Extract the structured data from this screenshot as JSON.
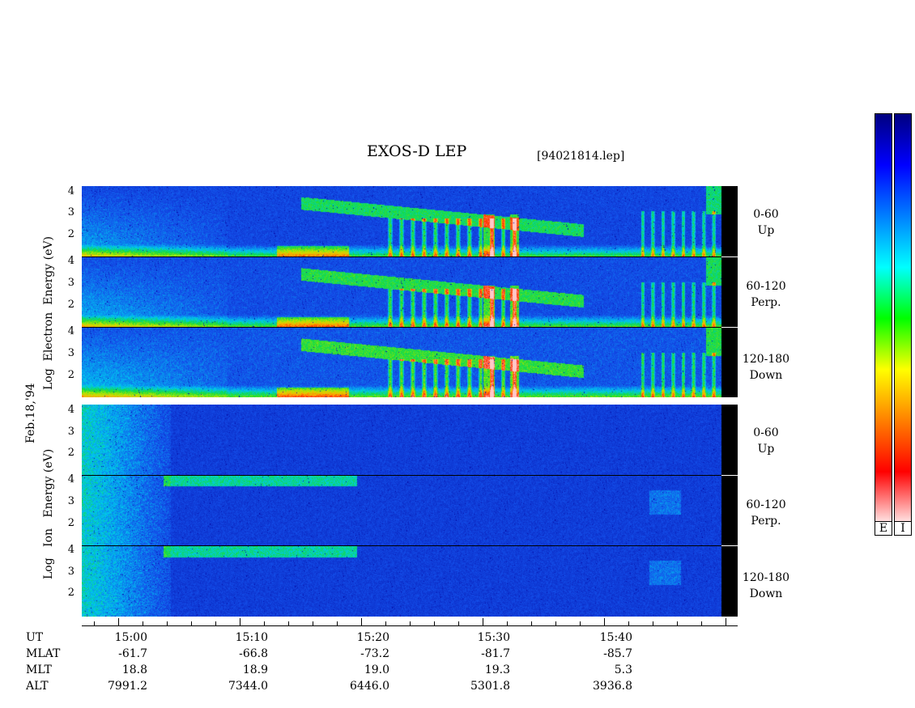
{
  "header": {
    "title": "EXOS-D LEP",
    "file_label": "[94021814.lep]"
  },
  "chart_data": {
    "type": "heatmap",
    "title": "EXOS-D LEP",
    "date_label": "Feb.18,'94",
    "x_axis": {
      "quantity": "UT",
      "tick_labels": [
        "15:00",
        "15:10",
        "15:20",
        "15:30",
        "15:40"
      ]
    },
    "electron": {
      "ylabel_words": [
        "Log",
        "Electron",
        "Energy",
        "(eV)"
      ],
      "ylabel": "Log Electron Energy (eV)",
      "yticks": [
        "4",
        "3",
        "2"
      ],
      "panels": [
        {
          "angle": "0-60",
          "direction": "Up"
        },
        {
          "angle": "60-120",
          "direction": "Perp."
        },
        {
          "angle": "120-180",
          "direction": "Down"
        }
      ]
    },
    "ion": {
      "ylabel_words": [
        "Log",
        "Ion",
        "Energy",
        "(eV)"
      ],
      "ylabel": "Log Ion Energy (eV)",
      "yticks": [
        "4",
        "3",
        "2"
      ],
      "panels": [
        {
          "angle": "0-60",
          "direction": "Up"
        },
        {
          "angle": "60-120",
          "direction": "Perp."
        },
        {
          "angle": "120-180",
          "direction": "Down"
        }
      ]
    },
    "colorbars": [
      {
        "label": "E",
        "colors": [
          "#ffe6e6",
          "#ff0000",
          "#ff8000",
          "#ffff00",
          "#00ff00",
          "#00ffff",
          "#0080ff",
          "#0000ff",
          "#000080"
        ]
      },
      {
        "label": "I",
        "colors": [
          "#ffe6e6",
          "#ff0000",
          "#ff8000",
          "#ffff00",
          "#00ff00",
          "#00ffff",
          "#0080ff",
          "#0000ff",
          "#000080"
        ]
      }
    ],
    "ephemeris": {
      "labels": [
        "UT",
        "MLAT",
        "MLT",
        "ALT"
      ],
      "columns": [
        {
          "UT": "15:00",
          "MLAT": "-61.7",
          "MLT": "18.8",
          "ALT": "7991.2"
        },
        {
          "UT": "15:10",
          "MLAT": "-66.8",
          "MLT": "18.9",
          "ALT": "7344.0"
        },
        {
          "UT": "15:20",
          "MLAT": "-73.2",
          "MLT": "19.0",
          "ALT": "6446.0"
        },
        {
          "UT": "15:30",
          "MLAT": "-81.7",
          "MLT": "19.3",
          "ALT": "5301.8"
        },
        {
          "UT": "15:40",
          "MLAT": "-85.7",
          "MLT": "5.3",
          "ALT": "3936.8"
        }
      ]
    }
  }
}
